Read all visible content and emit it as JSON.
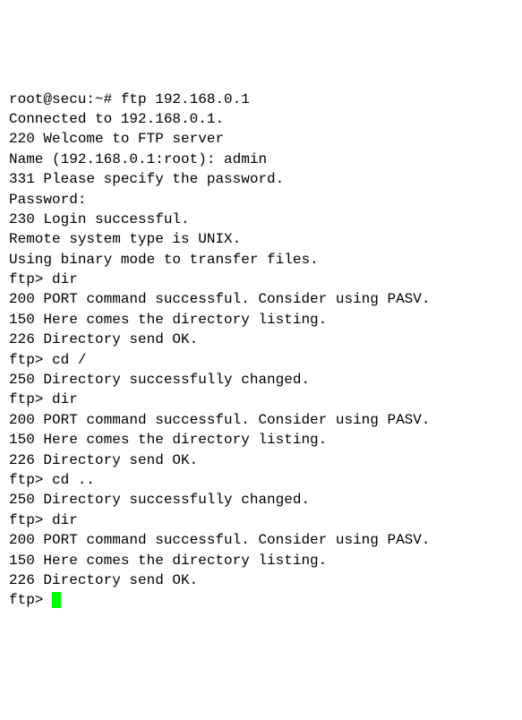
{
  "lines": {
    "l0": "root@secu:~# ftp 192.168.0.1",
    "l1": "Connected to 192.168.0.1.",
    "l2": "220 Welcome to FTP server",
    "l3": "Name (192.168.0.1:root): admin",
    "l4": "331 Please specify the password.",
    "l5": "Password:",
    "l6": "230 Login successful.",
    "l7": "Remote system type is UNIX.",
    "l8": "Using binary mode to transfer files.",
    "l9": "ftp> dir",
    "l10": "200 PORT command successful. Consider using PASV.",
    "l11": "150 Here comes the directory listing.",
    "l12": "226 Directory send OK.",
    "l13": "ftp> cd /",
    "l14": "250 Directory successfully changed.",
    "l15": "ftp> dir",
    "l16": "200 PORT command successful. Consider using PASV.",
    "l17": "150 Here comes the directory listing.",
    "l18": "226 Directory send OK.",
    "l19": "ftp> cd ..",
    "l20": "250 Directory successfully changed.",
    "l21": "ftp> dir",
    "l22": "200 PORT command successful. Consider using PASV.",
    "l23": "150 Here comes the directory listing.",
    "l24": "226 Directory send OK.",
    "l25_prompt": "ftp> "
  }
}
